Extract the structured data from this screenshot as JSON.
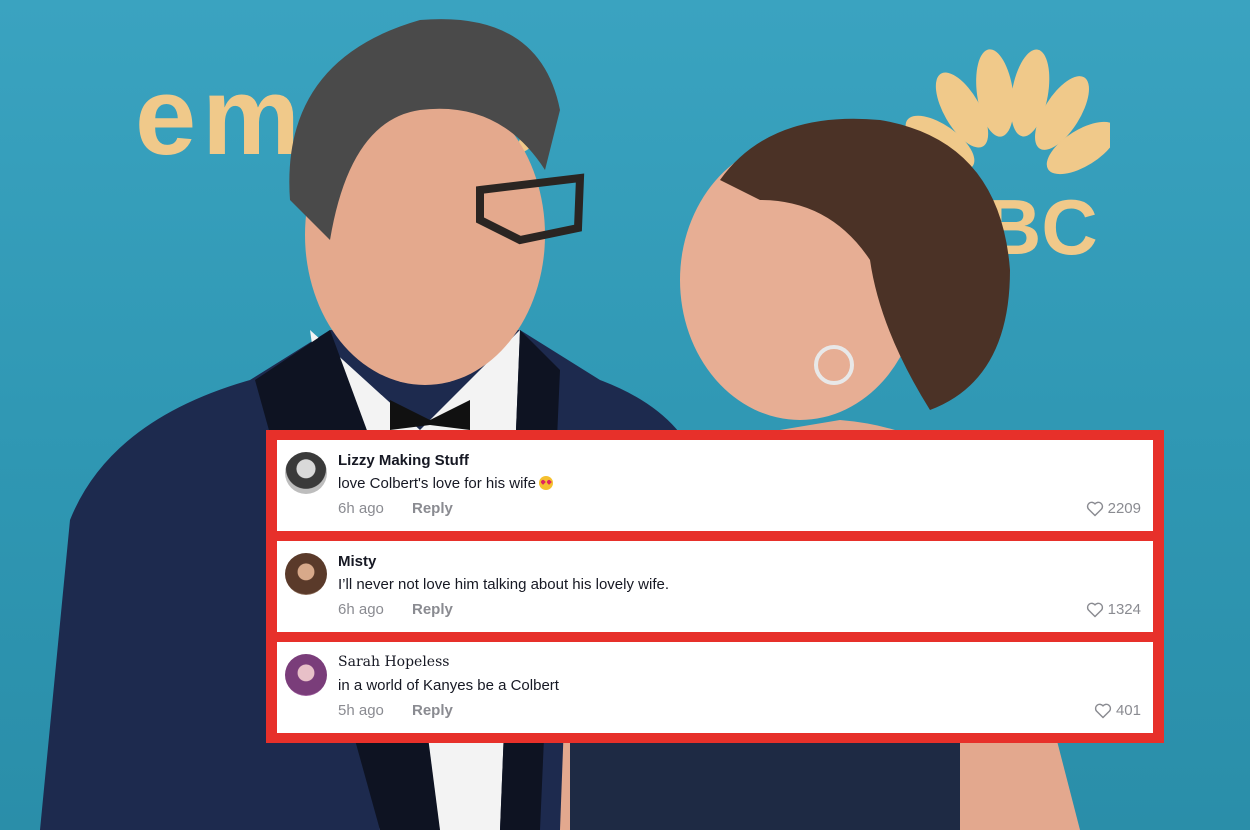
{
  "background": {
    "logo_text": "emmys",
    "network_text": "BC"
  },
  "comments": [
    {
      "author": "Lizzy Making Stuff",
      "text": "love Colbert's love for his wife",
      "emoji": "heart-eyes-emoji",
      "time": "6h ago",
      "reply_label": "Reply",
      "likes": "2209"
    },
    {
      "author": "Misty",
      "text": "I’ll never not love him talking about his lovely wife.",
      "time": "6h ago",
      "reply_label": "Reply",
      "likes": "1324"
    },
    {
      "author": "Sarah Hopeless",
      "text": "in a world of Kanyes be a Colbert",
      "time": "5h ago",
      "reply_label": "Reply",
      "likes": "401"
    }
  ],
  "colors": {
    "highlight_border": "#e7302a",
    "backdrop": "#2f98b5",
    "logo_gold": "#f0c98a"
  }
}
